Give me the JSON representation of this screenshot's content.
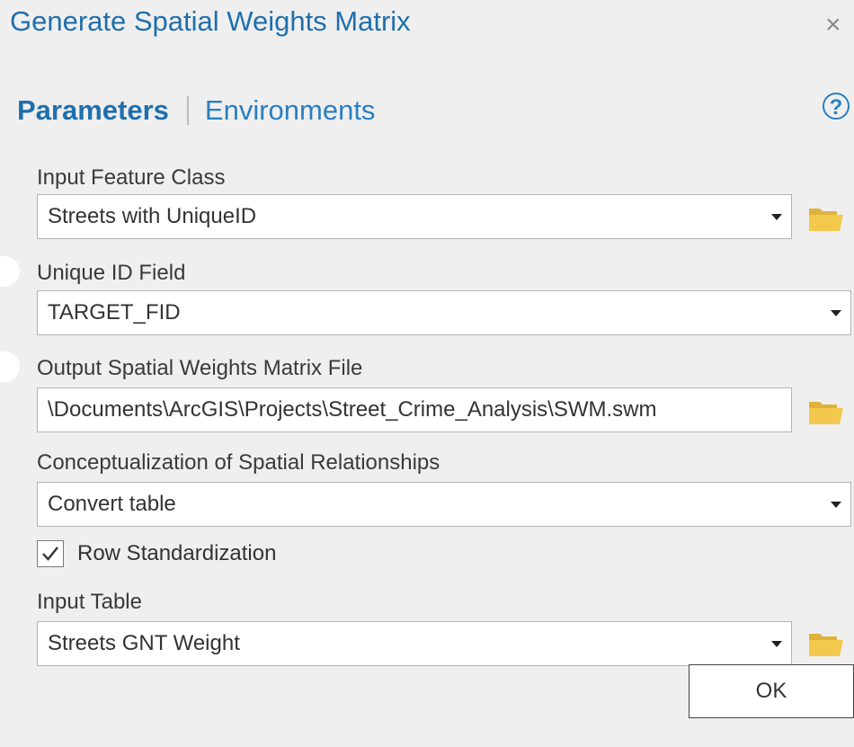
{
  "window": {
    "title": "Generate Spatial Weights Matrix",
    "close_label": "×"
  },
  "tabs": {
    "active": "Parameters",
    "inactive": "Environments",
    "help_label": "?"
  },
  "params": [
    {
      "label": "Input Feature Class",
      "value": "Streets with UniqueID",
      "dropdown": true,
      "browse": true
    },
    {
      "label": "Unique ID Field",
      "value": "TARGET_FID",
      "dropdown": true,
      "browse": false
    },
    {
      "label": "Output Spatial Weights Matrix File",
      "value": "\\Documents\\ArcGIS\\Projects\\Street_Crime_Analysis\\SWM.swm",
      "dropdown": false,
      "browse": true
    },
    {
      "label": "Conceptualization of Spatial Relationships",
      "value": "Convert table",
      "dropdown": true,
      "browse": false
    },
    {
      "label": "Input Table",
      "value": "Streets GNT Weight",
      "dropdown": true,
      "browse": true
    }
  ],
  "row_standardization": {
    "label": "Row Standardization",
    "checked": true
  },
  "footer": {
    "ok_label": "OK"
  },
  "colors": {
    "accent": "#1f6fad",
    "folder": "#f2c94c",
    "background": "#efefef"
  },
  "icons": [
    "close-icon",
    "help-icon",
    "chevron-down-icon",
    "folder-icon",
    "checkmark-icon"
  ]
}
